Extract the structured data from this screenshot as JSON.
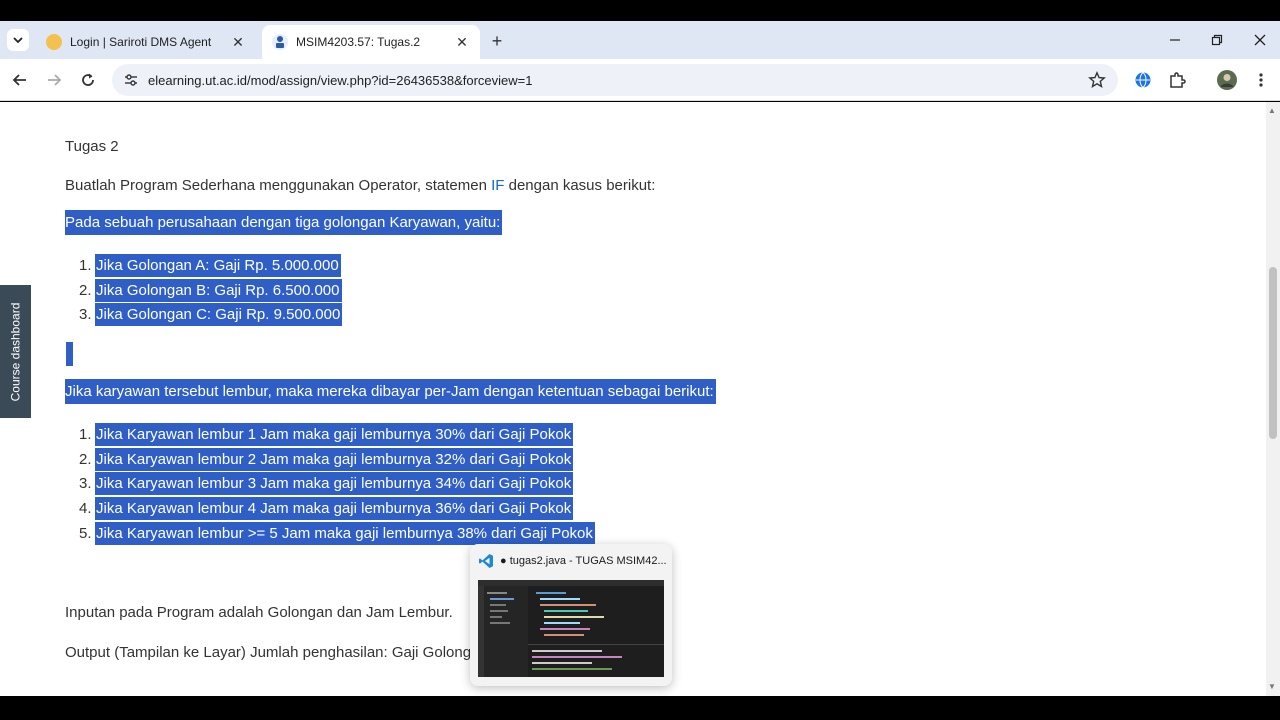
{
  "browser": {
    "tabs": [
      {
        "title": "Login | Sariroti DMS Agent",
        "active": false
      },
      {
        "title": "MSIM4203.57: Tugas.2",
        "active": true
      }
    ],
    "new_tab_label": "+",
    "url": "elearning.ut.ac.id/mod/assign/view.php?id=26436538&forceview=1"
  },
  "sidebar": {
    "course_dashboard_label": "Course dashboard"
  },
  "content": {
    "heading": "Tugas 2",
    "intro_before": "Buatlah Program Sederhana menggunakan Operator, statemen ",
    "intro_if": "IF",
    "intro_after": " dengan kasus berikut:",
    "golongan_intro": "Pada sebuah perusahaan dengan tiga golongan Karyawan, yaitu:",
    "golongan_list": [
      {
        "num": "1.",
        "text": "Jika Golongan A: Gaji Rp. 5.000.000"
      },
      {
        "num": "2.",
        "text": "Jika Golongan B: Gaji Rp. 6.500.000"
      },
      {
        "num": "3.",
        "text": "Jika Golongan C: Gaji Rp. 9.500.000"
      }
    ],
    "lembur_intro": "Jika karyawan tersebut lembur, maka mereka dibayar per-Jam dengan ketentuan sebagai berikut:",
    "lembur_list": [
      {
        "num": "1.",
        "text": "Jika Karyawan lembur 1 Jam maka gaji lemburnya 30% dari Gaji Pokok"
      },
      {
        "num": "2.",
        "text": "Jika Karyawan lembur 2 Jam maka gaji lemburnya 32% dari Gaji Pokok"
      },
      {
        "num": "3.",
        "text": "Jika Karyawan lembur 3 Jam maka gaji lemburnya 34% dari Gaji Pokok"
      },
      {
        "num": "4.",
        "text": "Jika Karyawan lembur 4 Jam maka gaji lemburnya 36% dari Gaji Pokok"
      },
      {
        "num": "5.",
        "text": "Jika Karyawan lembur >= 5 Jam maka gaji lemburnya 38% dari Gaji Pokok"
      }
    ],
    "input_text": "Inputan pada Program adalah Golongan dan Jam Lembur.",
    "output_text": "Output (Tampilan ke Layar) Jumlah penghasilan: Gaji Golong"
  },
  "taskbar_preview": {
    "title": "● tugas2.java - TUGAS MSIM42...",
    "app_icon": "vscode-icon"
  },
  "colors": {
    "selection": "#2f5fc6",
    "tabstrip": "#dfe7f5",
    "link": "#0f6cbf"
  }
}
